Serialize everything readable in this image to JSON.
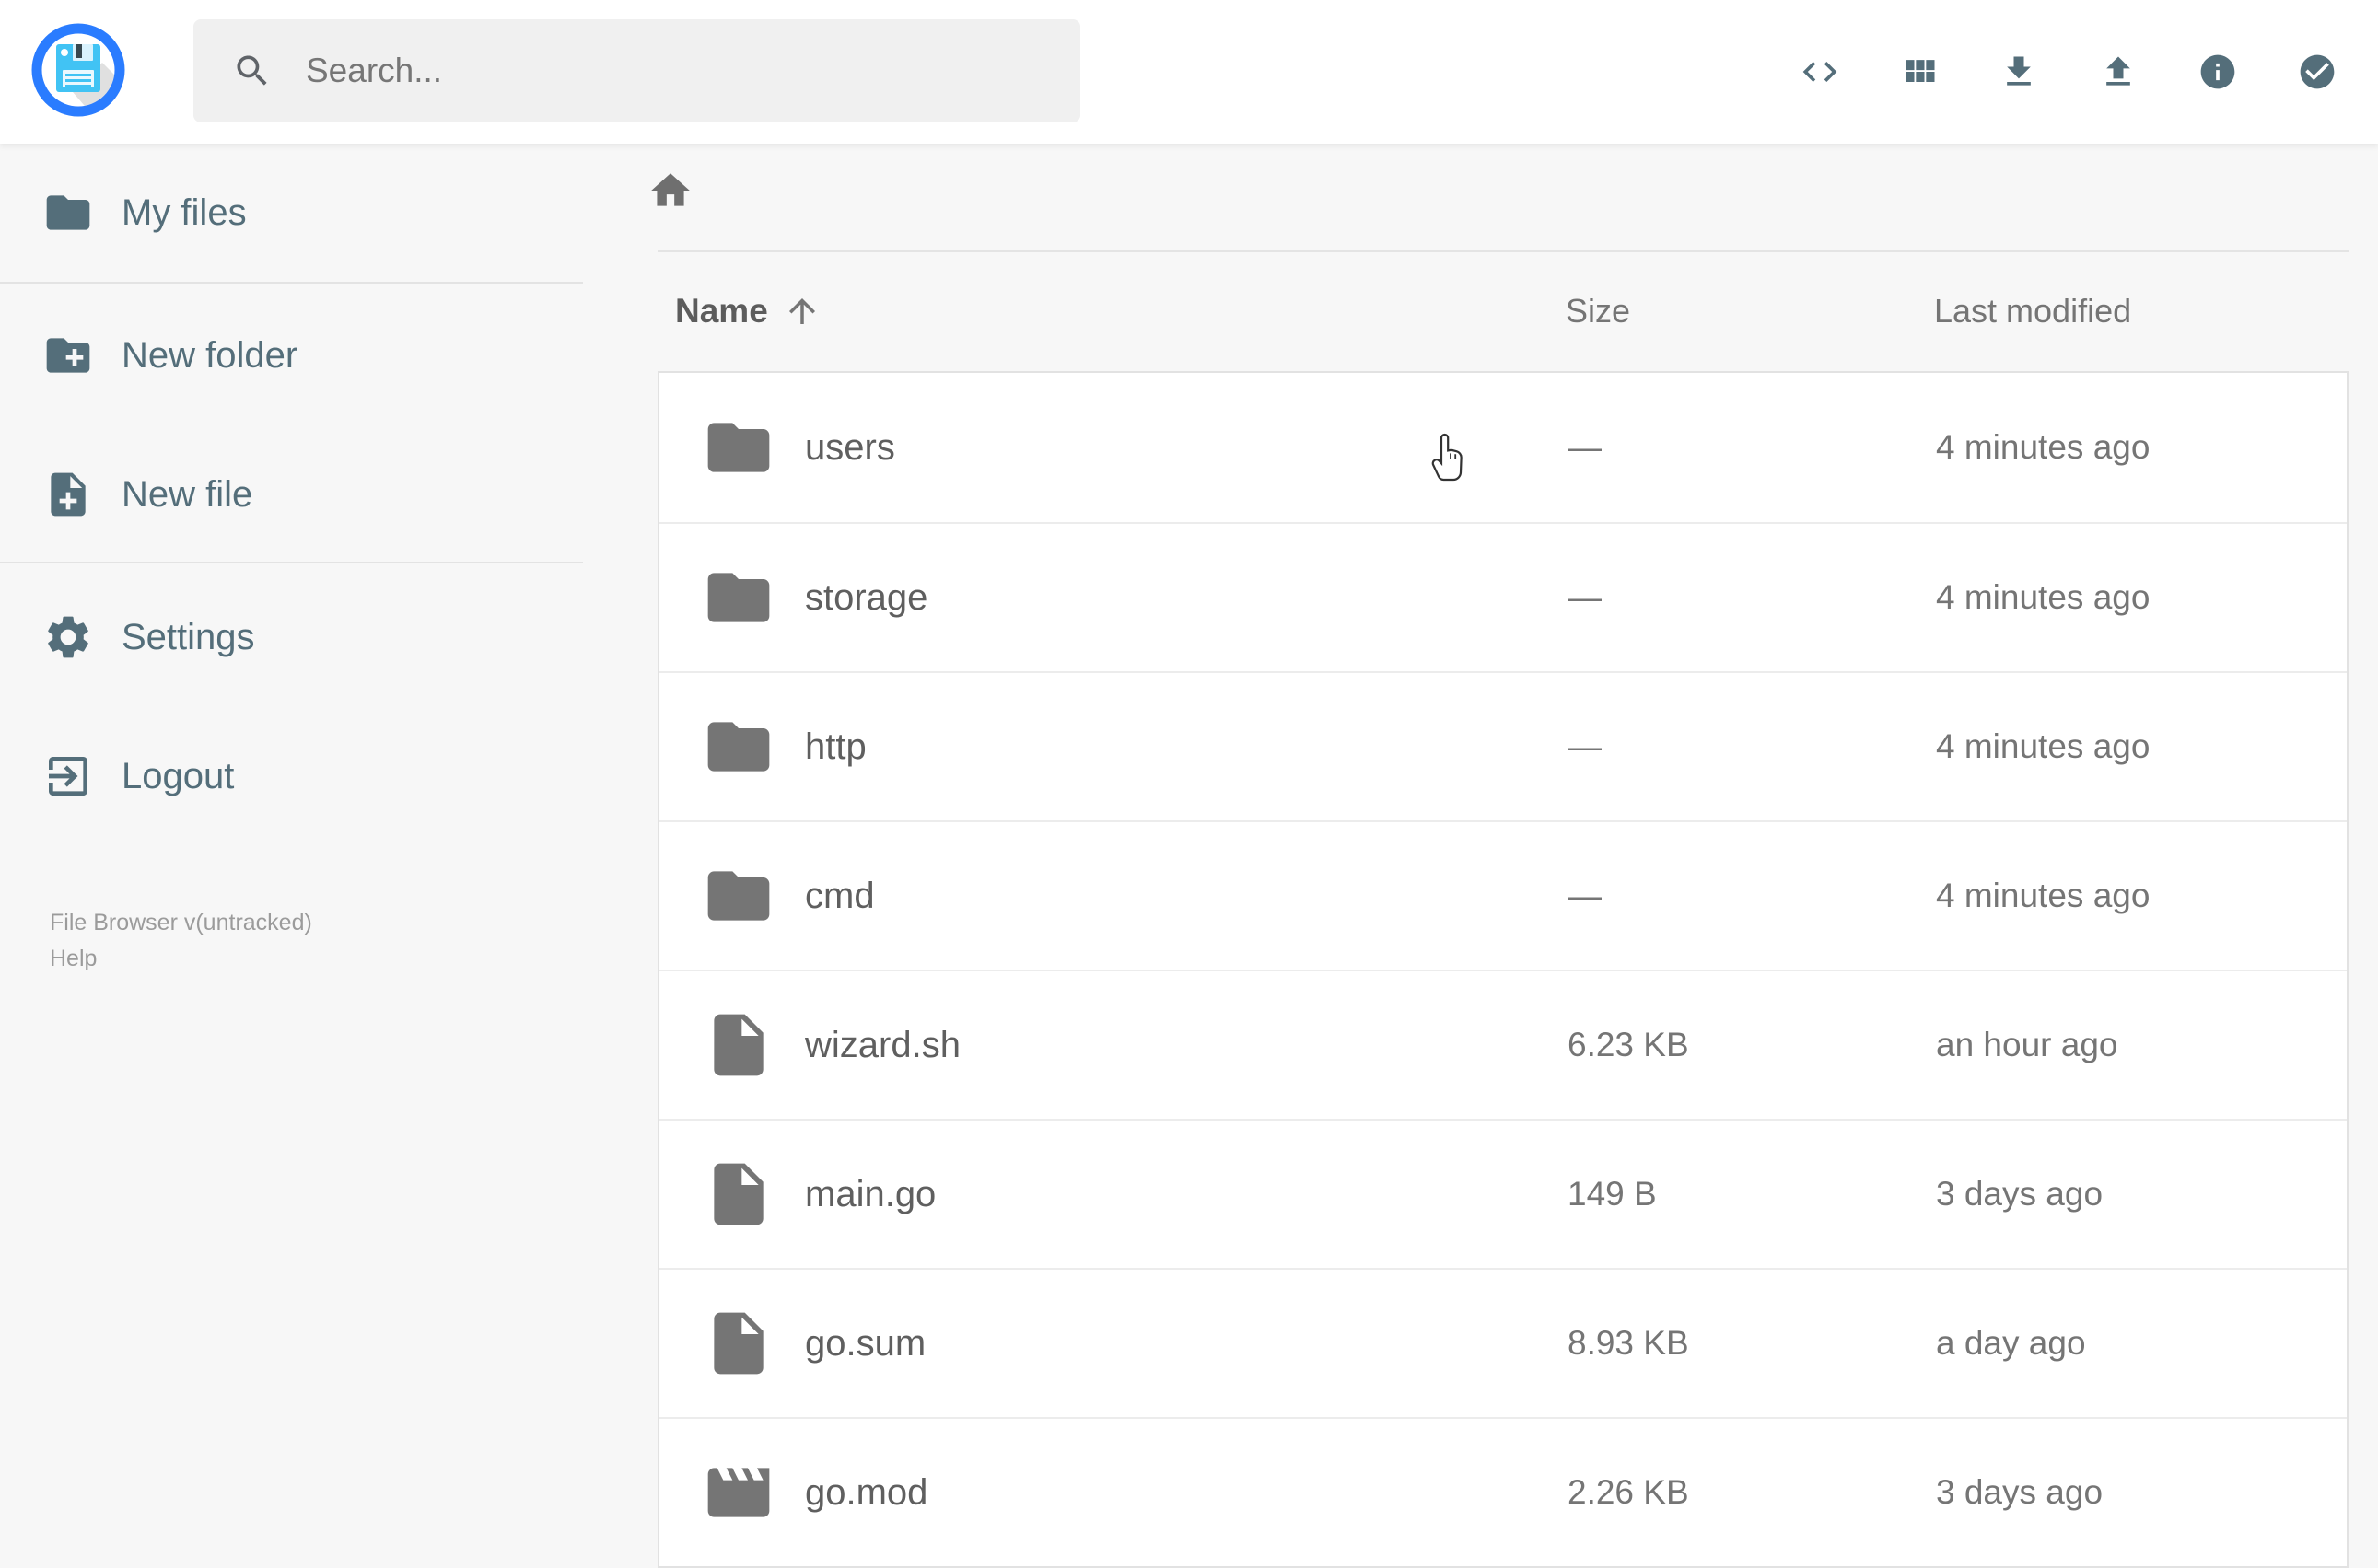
{
  "app": {
    "name": "File Browser",
    "accent_color": "#2979ff",
    "slate_color": "#546e7a",
    "icon_gray": "#757575"
  },
  "topbar": {
    "logo_icon": "floppy-disk-logo",
    "search": {
      "placeholder": "Search...",
      "value": "",
      "icon": "search"
    },
    "actions": [
      {
        "name": "raw-view",
        "icon": "code",
        "label": "Switch view"
      },
      {
        "name": "grid-view",
        "icon": "view-module",
        "label": "Switch view"
      },
      {
        "name": "download",
        "icon": "download",
        "label": "Download"
      },
      {
        "name": "upload",
        "icon": "upload",
        "label": "Upload"
      },
      {
        "name": "info",
        "icon": "info",
        "label": "Info"
      },
      {
        "name": "select-multiple",
        "icon": "check-circle",
        "label": "Select multiple"
      }
    ]
  },
  "sidebar": {
    "items": [
      {
        "type": "item",
        "name": "my-files",
        "label": "My files",
        "icon": "folder"
      },
      {
        "type": "divider"
      },
      {
        "type": "item",
        "name": "new-folder",
        "label": "New folder",
        "icon": "folder-plus"
      },
      {
        "type": "item",
        "name": "new-file",
        "label": "New file",
        "icon": "file-plus"
      },
      {
        "type": "divider"
      },
      {
        "type": "item",
        "name": "settings",
        "label": "Settings",
        "icon": "gear"
      },
      {
        "type": "item",
        "name": "logout",
        "label": "Logout",
        "icon": "logout"
      }
    ],
    "footer": {
      "version": "File Browser v(untracked)",
      "help": "Help"
    }
  },
  "breadcrumb": {
    "home_icon": "home"
  },
  "listing": {
    "headers": {
      "name": "Name",
      "size": "Size",
      "modified": "Last modified"
    },
    "sort": {
      "column": "name",
      "direction": "ascending",
      "icon": "arrow-up"
    },
    "rows": [
      {
        "name": "users",
        "icon": "folder",
        "size": "—",
        "modified": "4 minutes ago"
      },
      {
        "name": "storage",
        "icon": "folder",
        "size": "—",
        "modified": "4 minutes ago"
      },
      {
        "name": "http",
        "icon": "folder",
        "size": "—",
        "modified": "4 minutes ago"
      },
      {
        "name": "cmd",
        "icon": "folder",
        "size": "—",
        "modified": "4 minutes ago"
      },
      {
        "name": "wizard.sh",
        "icon": "file",
        "size": "6.23 KB",
        "modified": "an hour ago"
      },
      {
        "name": "main.go",
        "icon": "file",
        "size": "149 B",
        "modified": "3 days ago"
      },
      {
        "name": "go.sum",
        "icon": "file",
        "size": "8.93 KB",
        "modified": "a day ago"
      },
      {
        "name": "go.mod",
        "icon": "movie",
        "size": "2.26 KB",
        "modified": "3 days ago"
      }
    ]
  },
  "cursor": {
    "type": "hand-pointer",
    "over_row": "users"
  }
}
